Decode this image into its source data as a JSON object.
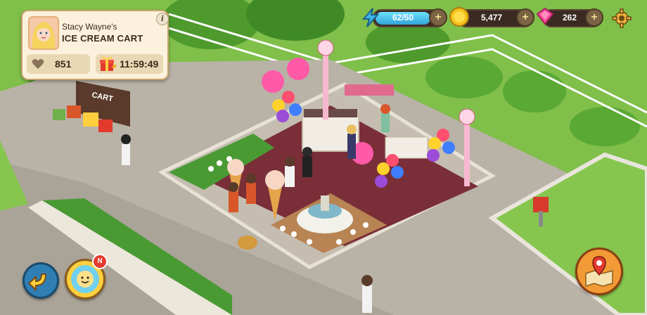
{
  "card": {
    "owner": "Stacy Wayne's",
    "shop_name": "ICE CREAM CART",
    "likes": "851",
    "timer": "11:59:49",
    "info_label": "i"
  },
  "currency": {
    "energy": "62/50",
    "energy_fill": 1.0,
    "coins": "5,477",
    "gems": "262",
    "plus_label": "+"
  },
  "sign_text": "CART",
  "friends_badge": "N",
  "colors": {
    "card_bg": "#fbf1dc",
    "energy": "#3fb6e8",
    "coin": "#f5c21b",
    "gem": "#ff4f9e",
    "grass": "#7fbf4a",
    "pavement": "#b9b2a7"
  },
  "icons": [
    "heart-icon",
    "gift-icon",
    "lightning-icon",
    "coin-icon",
    "gem-icon",
    "gear-icon",
    "back-arrow-icon",
    "friends-icon",
    "map-pin-icon"
  ]
}
